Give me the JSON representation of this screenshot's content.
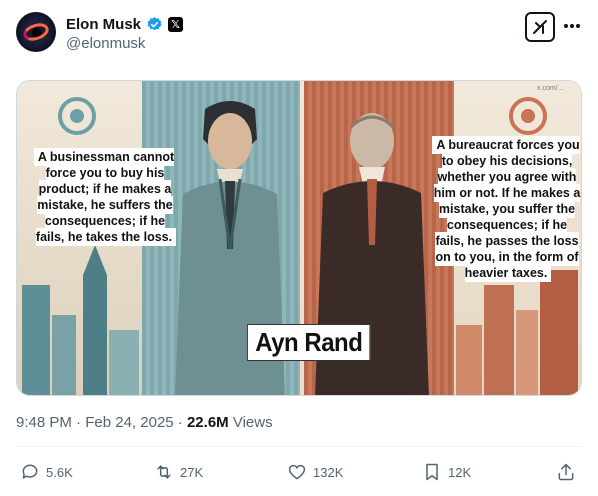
{
  "author": {
    "display_name": "Elon Musk",
    "handle": "@elonmusk",
    "avatar_icon": "avatar-image",
    "verified_color": "#1d9bf0",
    "affiliation_badge": "𝕏"
  },
  "header_actions": {
    "grok_icon": "grok-icon",
    "more_icon": "more-icon"
  },
  "media": {
    "left_caption": "A businessman cannot force you to buy his product; if he makes a mistake, he suffers the consequences; if he fails, he takes the loss.",
    "right_caption": "A bureaucrat forces you to obey his decisions, whether you agree with him or not. If he makes a mistake, you suffer the consequences; if he fails, he passes the loss on to you, in the form of heavier taxes.",
    "title_label": "Ayn Rand",
    "watermark": "x.com/..."
  },
  "meta": {
    "time": "9:48 PM",
    "separator": " · ",
    "date": "Feb 24, 2025",
    "separator2": " · ",
    "views_count": "22.6M",
    "views_label": " Views"
  },
  "actions": {
    "replies": "5.6K",
    "reposts": "27K",
    "likes": "132K",
    "bookmarks": "12K"
  },
  "colors": {
    "text": "#0f1419",
    "secondary": "#536471",
    "teal": "#7fa8ad",
    "rust": "#b8664a"
  }
}
